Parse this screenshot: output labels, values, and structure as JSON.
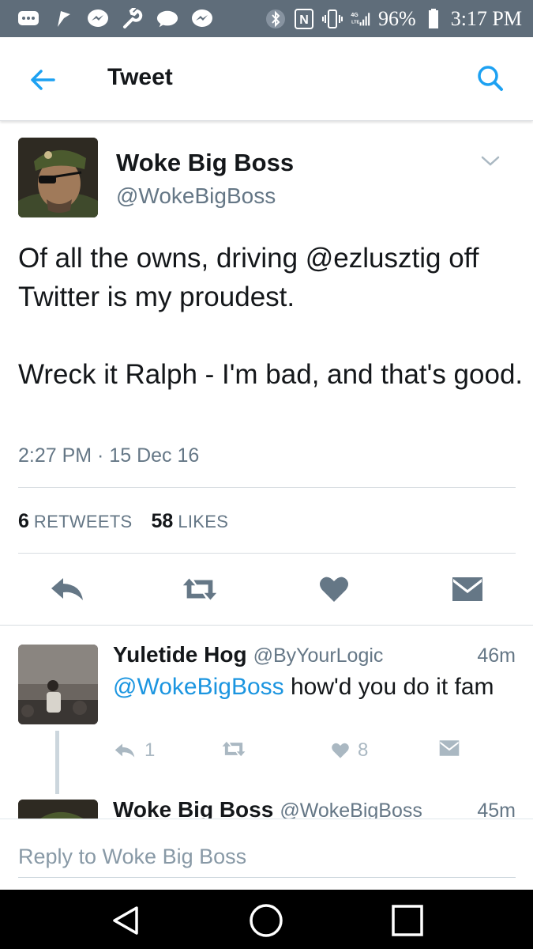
{
  "status_bar": {
    "battery": "96%",
    "time": "3:17 PM",
    "network": "4G LTE",
    "icons": [
      "messages-icon",
      "flag-icon",
      "messenger-icon",
      "wrench-icon",
      "chat-bubble-icon",
      "messenger-icon",
      "bluetooth-icon",
      "nfc-icon",
      "vibrate-icon",
      "signal-icon",
      "battery-icon"
    ]
  },
  "header": {
    "title": "Tweet"
  },
  "tweet": {
    "author_name": "Woke Big Boss",
    "author_handle": "@WokeBigBoss",
    "text_line1": "Of all the owns, driving @ezlusztig off Twitter is my proudest.",
    "text_line2": "Wreck it Ralph - I'm bad, and that's good.",
    "timestamp": "2:27 PM · 15 Dec 16",
    "retweets_count": "6",
    "retweets_label": "RETWEETS",
    "likes_count": "58",
    "likes_label": "LIKES"
  },
  "replies": [
    {
      "name": "Yuletide Hog",
      "handle": "@ByYourLogic",
      "time": "46m",
      "mention": "@WokeBigBoss",
      "text": " how'd you do it fam",
      "reply_count": "1",
      "like_count": "8"
    },
    {
      "name": "Woke Big Boss",
      "handle": "@WokeBigBoss",
      "time": "45m"
    }
  ],
  "reply_box": {
    "placeholder": "Reply to Woke Big Boss"
  },
  "colors": {
    "accent": "#1da1f2",
    "mention": "#1b95e0",
    "status_bar_bg": "#5f6d7a",
    "icon_gray": "#657786",
    "muted_icon": "#aab8c2"
  }
}
